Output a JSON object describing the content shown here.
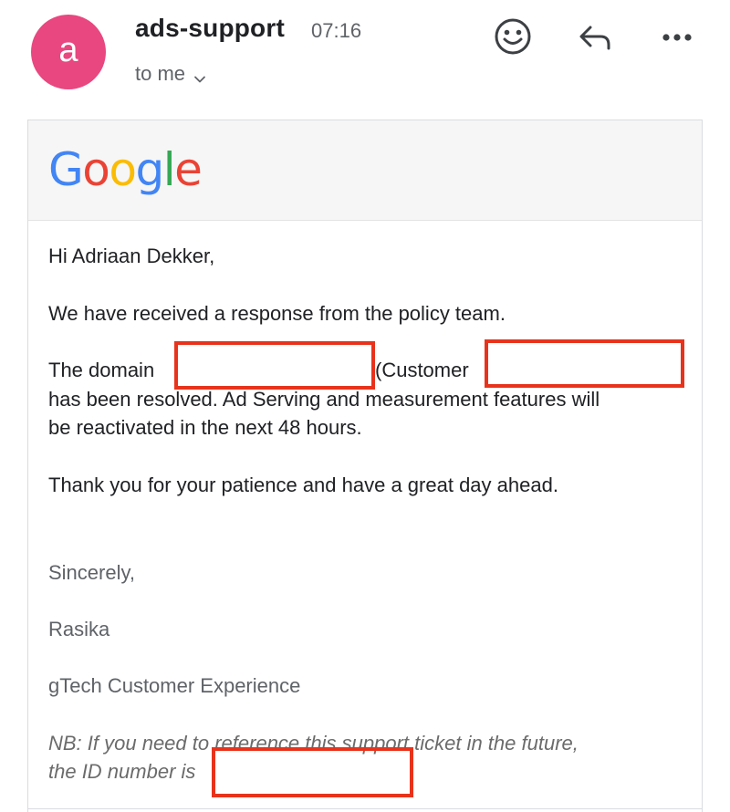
{
  "header": {
    "avatar_letter": "a",
    "sender": "ads-support",
    "time": "07:16",
    "recipient": "to me",
    "icons": [
      "emoji-icon",
      "reply-icon",
      "more-icon"
    ]
  },
  "email": {
    "logo_letters": [
      "G",
      "o",
      "o",
      "g",
      "l",
      "e"
    ],
    "greeting": "Hi Adriaan Dekker,",
    "p1": "We have received a response from the policy team.",
    "p2_prefix": "The domain",
    "p2_customer": "(Customer",
    "p2_line2": "has been resolved. Ad Serving and measurement features will",
    "p2_line3": "be reactivated in the next 48 hours.",
    "p3": "Thank you for your patience and have a great day ahead.",
    "closing": "Sincerely,",
    "signer": "Rasika",
    "team": "gTech Customer Experience",
    "nb_line1": "NB: If you need to reference this support ticket in the future,",
    "nb_line2": "the ID number is"
  },
  "colors": {
    "avatar": "#e8477f",
    "redaction": "#e8331c",
    "google_blue": "#4285f4",
    "google_red": "#ea4335",
    "google_yellow": "#fbbc05",
    "google_green": "#34a853"
  }
}
